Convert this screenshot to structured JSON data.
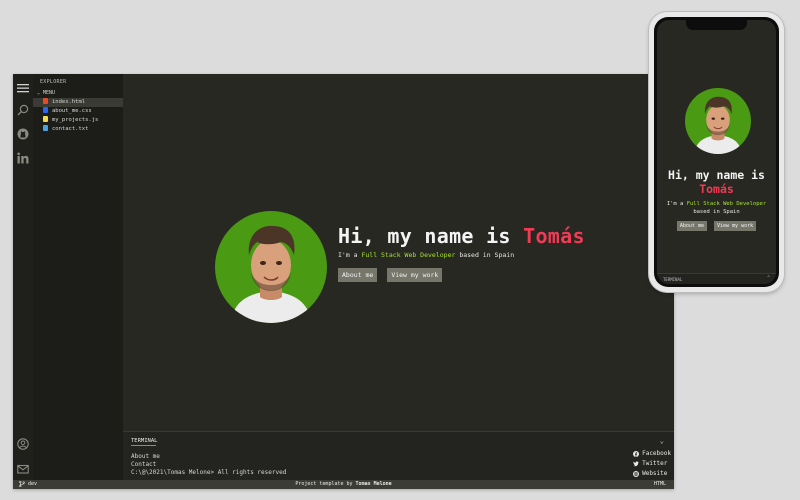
{
  "explorer": {
    "title": "EXPLORER",
    "section": "MENU",
    "files": [
      {
        "name": "index.html",
        "color": "#e44d26"
      },
      {
        "name": "about_me.css",
        "color": "#2965f1"
      },
      {
        "name": "my_projects.js",
        "color": "#f0db4f"
      },
      {
        "name": "contact.txt",
        "color": "#4aa3df"
      }
    ]
  },
  "activity_icons": [
    "menu-icon",
    "search-icon",
    "github-icon",
    "linkedin-icon",
    "user-icon",
    "mail-icon"
  ],
  "hero": {
    "greeting": "Hi, my name is ",
    "name": "Tomás",
    "intro": "I'm a ",
    "role": "Full Stack Web Developer",
    "location": " based in Spain",
    "about_button": "About me",
    "work_button": "View my work"
  },
  "terminal": {
    "title": "TERMINAL",
    "lines": [
      "About me",
      "Contact",
      "C:\\@\\2021\\Tomas Melone> All rights reserved"
    ],
    "socials": [
      {
        "label": "Facebook",
        "icon": "facebook-icon"
      },
      {
        "label": "Twitter",
        "icon": "twitter-icon"
      },
      {
        "label": "Website",
        "icon": "globe-icon"
      }
    ]
  },
  "statusbar": {
    "branch": "dev",
    "center_prefix": "Project template by ",
    "center_author": "Tomas Melone",
    "language": "HTML"
  },
  "mobile": {
    "greeting": "Hi, my name is",
    "name": "Tomás",
    "intro": "I'm a ",
    "role": "Full Stack Web Developer",
    "location": "based in Spain",
    "about_button": "About me",
    "work_button": "View my work",
    "terminal_title": "TERMINAL"
  },
  "colors": {
    "background": "#272822",
    "accent_name": "#f23a55",
    "accent_role": "#a6e22e",
    "avatar_bg": "#4a9a14",
    "button": "#76766a"
  }
}
